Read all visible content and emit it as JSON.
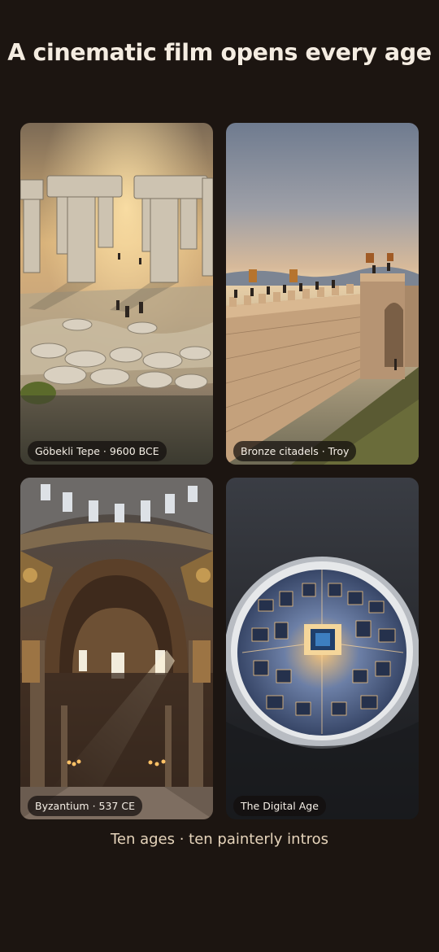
{
  "headline": "A cinematic film opens every age",
  "cards": [
    {
      "label": "Göbekli Tepe · 9600 BCE"
    },
    {
      "label": "Bronze citadels · Troy"
    },
    {
      "label": "Byzantium · 537 CE"
    },
    {
      "label": "The Digital Age"
    }
  ],
  "caption": "Ten ages · ten painterly intros",
  "colors": {
    "background": "#1c1511",
    "headline": "#f4ece1",
    "caption": "#e6d4bb"
  }
}
